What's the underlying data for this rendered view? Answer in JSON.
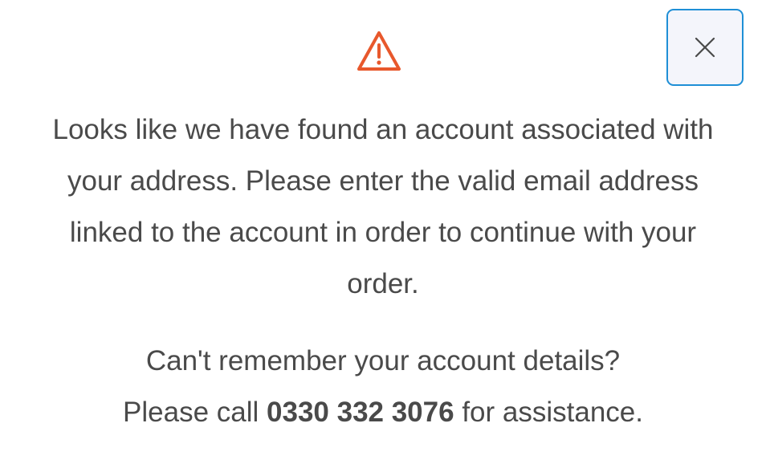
{
  "dialog": {
    "icons": {
      "warning": "warning-triangle-icon",
      "close": "close-icon"
    },
    "colors": {
      "warning": "#e8582c",
      "close_border": "#1f8fd6",
      "close_background": "#f4f5fb",
      "text": "#4a4a4a"
    },
    "message": "Looks like we have found an account associated with your address. Please enter the valid email address linked to the account in order to continue with your order.",
    "help": {
      "question": "Can't remember your account details?",
      "call_prefix": "Please call",
      "phone": "0330 332 3076",
      "call_suffix": "for assistance."
    }
  }
}
